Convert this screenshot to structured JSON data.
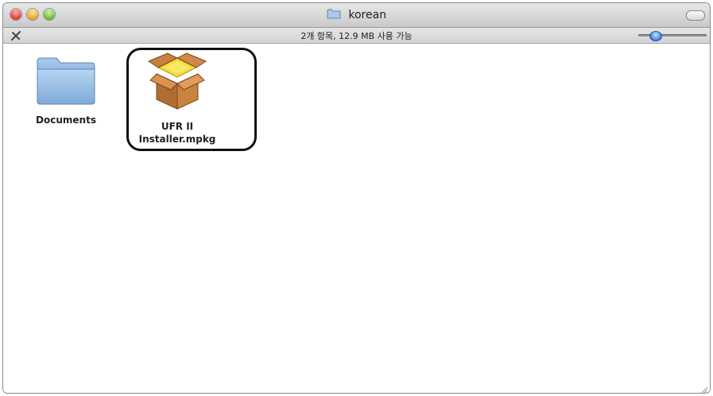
{
  "window": {
    "title": "korean",
    "status_text": "2개 항목, 12.9 MB 사용 가능"
  },
  "items": [
    {
      "name": "Documents",
      "icon": "folder-icon"
    },
    {
      "name_line1": "UFR II",
      "name_line2": "Installer.mpkg",
      "icon": "package-icon",
      "highlighted": true
    }
  ],
  "colors": {
    "folder_blue": "#8fb8e0",
    "package_brown": "#b8753a",
    "package_yellow": "#f3dd3a",
    "highlight_border": "#111111"
  }
}
